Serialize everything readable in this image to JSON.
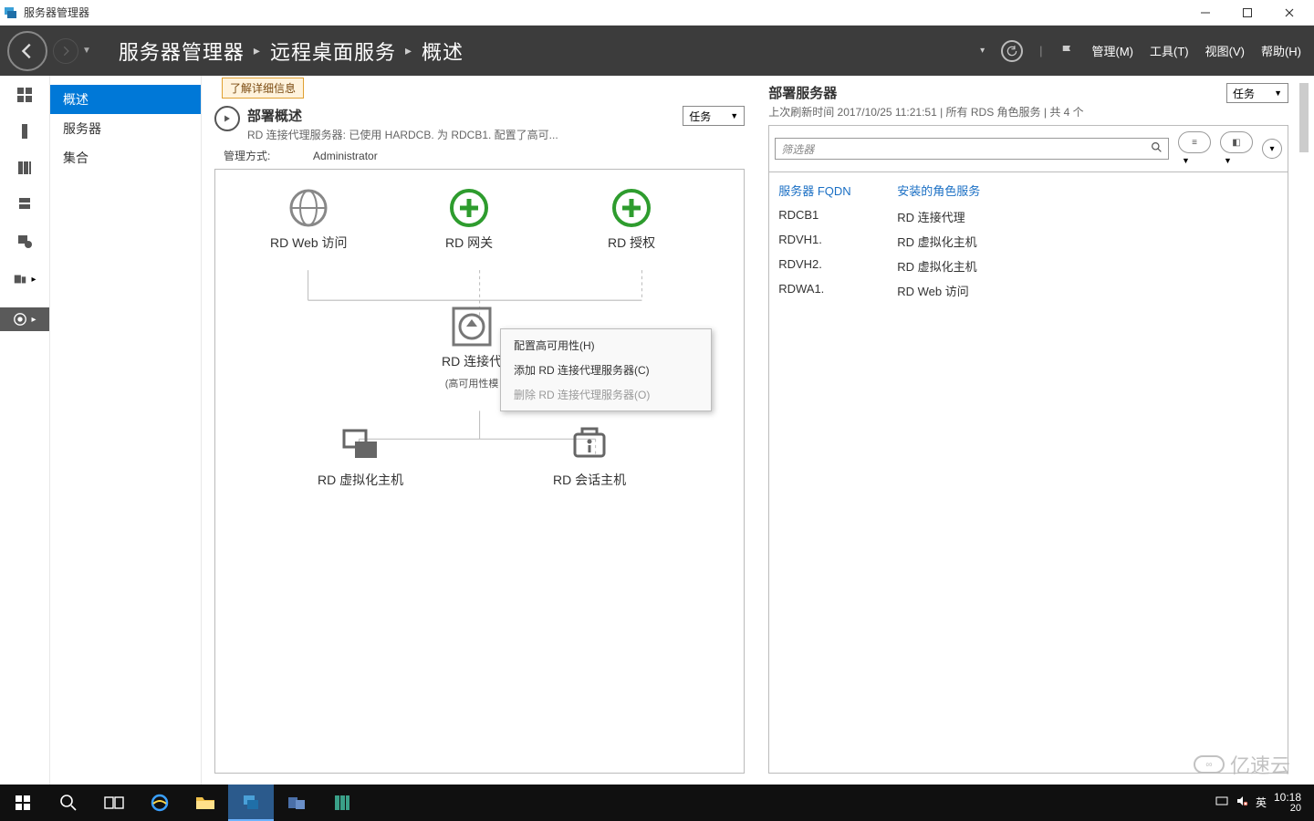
{
  "window": {
    "title": "服务器管理器"
  },
  "breadcrumb": {
    "root": "服务器管理器",
    "mid": "远程桌面服务",
    "leaf": "概述"
  },
  "menus": {
    "manage": "管理(M)",
    "tools": "工具(T)",
    "view": "视图(V)",
    "help": "帮助(H)"
  },
  "sidebar": {
    "items": [
      "概述",
      "服务器",
      "集合"
    ]
  },
  "info_banner": "了解详细信息",
  "deploy_overview": {
    "title": "部署概述",
    "subtitle": "RD 连接代理服务器: 已使用 HARDCB.            为 RDCB1.              配置了高可...",
    "tasks": "任务",
    "managed_as_label": "管理方式:",
    "managed_as_value": "Administrator",
    "nodes": {
      "rd_web": "RD Web 访问",
      "rd_gateway": "RD 网关",
      "rd_license": "RD 授权",
      "rd_cb": "RD 连接代",
      "rd_cb_sub": "(高可用性模",
      "rd_vh": "RD 虚拟化主机",
      "rd_sh": "RD 会话主机"
    },
    "context_menu": {
      "configure_ha": "配置高可用性(H)",
      "add_cb": "添加 RD 连接代理服务器(C)",
      "remove_cb": "删除 RD 连接代理服务器(O)"
    }
  },
  "deploy_servers": {
    "title": "部署服务器",
    "subtitle": "上次刷新时间 2017/10/25 11:21:51 | 所有 RDS 角色服务  | 共 4 个",
    "tasks": "任务",
    "filter_placeholder": "筛选器",
    "columns": {
      "fqdn": "服务器 FQDN",
      "role": "安装的角色服务"
    },
    "rows": [
      {
        "fqdn": "RDCB1",
        "role": "RD 连接代理"
      },
      {
        "fqdn": "RDVH1.",
        "role": "RD 虚拟化主机"
      },
      {
        "fqdn": "RDVH2.",
        "role": "RD 虚拟化主机"
      },
      {
        "fqdn": "RDWA1.",
        "role": "RD Web 访问"
      }
    ]
  },
  "taskbar": {
    "clock": "10:18",
    "date": "20",
    "ime": "英"
  },
  "watermark": "亿速云"
}
